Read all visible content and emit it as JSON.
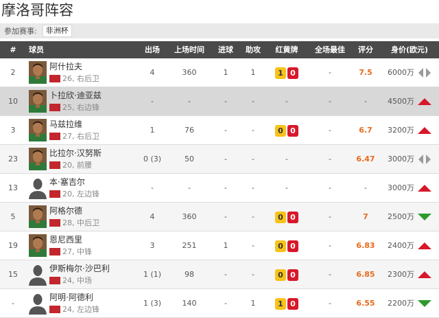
{
  "page_title": "摩洛哥阵容",
  "filter": {
    "label": "参加赛事:",
    "value": "非洲杯"
  },
  "columns": {
    "num": "#",
    "player": "球员",
    "appearances": "出场",
    "minutes": "上场时间",
    "goals": "进球",
    "assists": "助攻",
    "cards": "红黄牌",
    "best": "全场最佳",
    "rating": "评分",
    "value": "身价(欧元)"
  },
  "players": [
    {
      "num": "2",
      "name": "阿什拉夫",
      "meta": "26, 右后卫",
      "apps": "4",
      "mins": "360",
      "goals": "1",
      "assists": "1",
      "yellow": "1",
      "red": "0",
      "best": "-",
      "rating": "7.5",
      "value": "6000万",
      "trend": "flat",
      "avatar": "photo",
      "row_style": "normal"
    },
    {
      "num": "10",
      "name": "卜拉欣·迪亚兹",
      "meta": "25, 右边锋",
      "apps": "-",
      "mins": "-",
      "goals": "-",
      "assists": "-",
      "yellow": "",
      "red": "",
      "best": "-",
      "rating": "",
      "value": "4500万",
      "trend": "up",
      "avatar": "photo",
      "row_style": "highlight"
    },
    {
      "num": "3",
      "name": "马兹拉维",
      "meta": "27, 右后卫",
      "apps": "1",
      "mins": "76",
      "goals": "-",
      "assists": "-",
      "yellow": "0",
      "red": "0",
      "best": "-",
      "rating": "6.7",
      "value": "3200万",
      "trend": "up",
      "avatar": "photo",
      "row_style": "normal"
    },
    {
      "num": "23",
      "name": "比拉尔·汉努斯",
      "meta": "20, 前腰",
      "apps": "0 (3)",
      "mins": "50",
      "goals": "-",
      "assists": "-",
      "yellow": "",
      "red": "",
      "best": "-",
      "rating": "6.47",
      "value": "3000万",
      "trend": "flat",
      "avatar": "photo",
      "row_style": "shade"
    },
    {
      "num": "13",
      "name": "本·塞吉尔",
      "meta": "20, 左边锋",
      "apps": "-",
      "mins": "-",
      "goals": "-",
      "assists": "-",
      "yellow": "",
      "red": "",
      "best": "-",
      "rating": "",
      "value": "3000万",
      "trend": "up",
      "avatar": "silhouette",
      "row_style": "normal"
    },
    {
      "num": "5",
      "name": "阿格尔德",
      "meta": "28, 中后卫",
      "apps": "4",
      "mins": "360",
      "goals": "-",
      "assists": "-",
      "yellow": "0",
      "red": "0",
      "best": "-",
      "rating": "7",
      "value": "2500万",
      "trend": "down",
      "avatar": "photo",
      "row_style": "shade"
    },
    {
      "num": "19",
      "name": "恩尼西里",
      "meta": "27, 中锋",
      "apps": "3",
      "mins": "251",
      "goals": "1",
      "assists": "-",
      "yellow": "0",
      "red": "0",
      "best": "-",
      "rating": "6.83",
      "value": "2400万",
      "trend": "up",
      "avatar": "photo",
      "row_style": "normal"
    },
    {
      "num": "15",
      "name": "伊斯梅尔·沙巴利",
      "meta": "24, 中场",
      "apps": "1 (1)",
      "mins": "98",
      "goals": "-",
      "assists": "-",
      "yellow": "0",
      "red": "0",
      "best": "-",
      "rating": "6.85",
      "value": "2300万",
      "trend": "up",
      "avatar": "silhouette",
      "row_style": "shade"
    },
    {
      "num": "-",
      "name": "阿明·阿德利",
      "meta": "24, 左边锋",
      "apps": "1 (3)",
      "mins": "140",
      "goals": "-",
      "assists": "1",
      "yellow": "1",
      "red": "0",
      "best": "-",
      "rating": "6.55",
      "value": "2200万",
      "trend": "down",
      "avatar": "silhouette",
      "row_style": "normal"
    }
  ],
  "colors": {
    "header_bg": "#4a4a4a",
    "rating": "#e86a1a",
    "yellow_card": "#f7c31a",
    "red_card": "#d7182a",
    "trend_up": "#d7182a",
    "trend_down": "#2e9a2e",
    "trend_flat": "#9a9a9a",
    "flag": "#c1272d"
  }
}
